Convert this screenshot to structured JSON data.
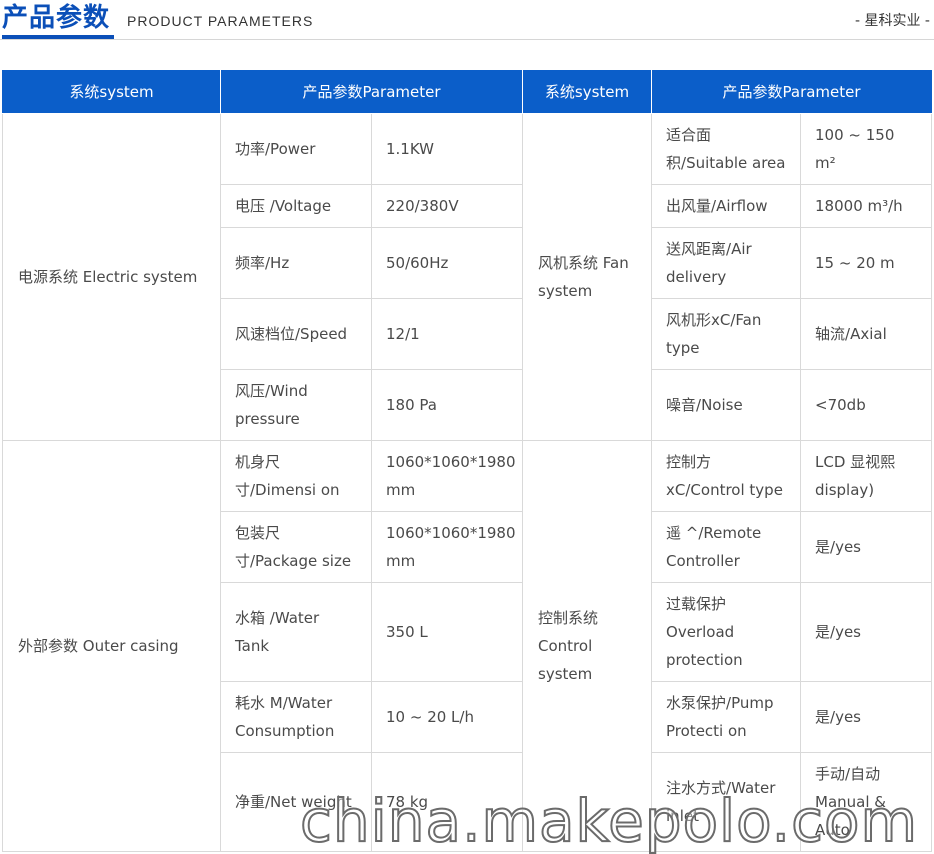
{
  "header": {
    "title": "产品参数",
    "subtitle": "PRODUCT PARAMETERS",
    "brand": "- 星科实业 -"
  },
  "table": {
    "headers": [
      "系统system",
      "产品参数Parameter",
      "系统system",
      "产品参数Parameter"
    ],
    "left_groups": [
      {
        "category": "电源系统 Electric system",
        "rows": [
          {
            "name": "功率/Power",
            "value": "1.1KW"
          },
          {
            "name": "电压 /Voltage",
            "value": "220/380V"
          },
          {
            "name": "频率/Hz",
            "value": "50/60Hz"
          },
          {
            "name": "风速档位/Speed",
            "value": "12/1"
          },
          {
            "name": "风压/Wind pressure",
            "value": "180 Pa"
          }
        ]
      },
      {
        "category": "外部参数 Outer casing",
        "rows": [
          {
            "name": "机身尺寸/Dimensi on",
            "value": "1060*1060*1980 mm"
          },
          {
            "name": "包装尺寸/Package size",
            "value": "1060*1060*1980 mm"
          },
          {
            "name": "水箱 /Water Tank",
            "value": "350 L"
          },
          {
            "name": "耗水 M/Water Consumption",
            "value": "10 ~ 20 L/h"
          },
          {
            "name": "净重/Net weight",
            "value": "78 kg"
          }
        ]
      }
    ],
    "right_groups": [
      {
        "category": "风机系统 Fan system",
        "rows": [
          {
            "name": "适合面积/Suitable area",
            "value": "100 ~ 150 m²"
          },
          {
            "name": "出风量/Airflow",
            "value": "18000 m³/h"
          },
          {
            "name": "送风距离/Air delivery",
            "value": "15 ~ 20 m"
          },
          {
            "name": "风机形xC/Fan type",
            "value": "轴流/Axial"
          },
          {
            "name": "噪音/Noise",
            "value": "<70db"
          }
        ]
      },
      {
        "category": "控制系统 Control system",
        "rows": [
          {
            "name": "控制方xC/Control type",
            "value": "LCD 显视熙display)"
          },
          {
            "name": "遥 ^/Remote Controller",
            "value": "是/yes"
          },
          {
            "name": "过载保护 Overload protection",
            "value": "是/yes"
          },
          {
            "name": "水泵保护/Pump Protecti on",
            "value": "是/yes"
          },
          {
            "name": "注水方式/Water inlet",
            "value": "手动/自动 Manual & Auto"
          }
        ]
      }
    ]
  },
  "watermark": "china.makepolo.com"
}
